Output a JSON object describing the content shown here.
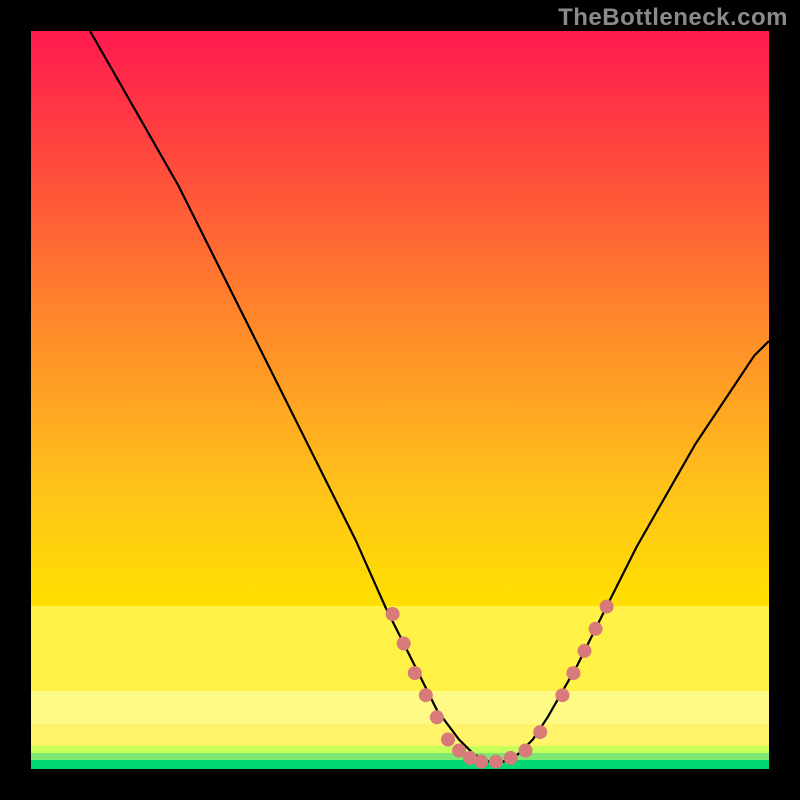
{
  "watermark": "TheBottleneck.com",
  "chart_data": {
    "type": "line",
    "title": "",
    "xlabel": "",
    "ylabel": "",
    "xlim": [
      0,
      100
    ],
    "ylim": [
      0,
      100
    ],
    "grid": false,
    "background": {
      "top_color": "#ff1a4f",
      "mid_color": "#ffd400",
      "bottom_color": "#00e070",
      "highlight_band": true,
      "highlight_color": "#ffff99"
    },
    "series": [
      {
        "name": "bottleneck-curve",
        "color": "#000000",
        "x": [
          8,
          12,
          16,
          20,
          24,
          28,
          32,
          36,
          40,
          44,
          48,
          52,
          55,
          58,
          60,
          62,
          64,
          66,
          68,
          70,
          74,
          78,
          82,
          86,
          90,
          94,
          98,
          100
        ],
        "y": [
          100,
          93,
          86,
          79,
          71,
          63,
          55,
          47,
          39,
          31,
          22,
          14,
          8,
          4,
          2,
          1,
          1,
          2,
          4,
          7,
          14,
          22,
          30,
          37,
          44,
          50,
          56,
          58
        ]
      }
    ],
    "markers": {
      "name": "highlight-dots",
      "color": "#d97a7a",
      "radius": 7,
      "points": [
        {
          "x": 49,
          "y": 21
        },
        {
          "x": 50.5,
          "y": 17
        },
        {
          "x": 52,
          "y": 13
        },
        {
          "x": 53.5,
          "y": 10
        },
        {
          "x": 55,
          "y": 7
        },
        {
          "x": 56.5,
          "y": 4
        },
        {
          "x": 58,
          "y": 2.5
        },
        {
          "x": 59.5,
          "y": 1.5
        },
        {
          "x": 61,
          "y": 1
        },
        {
          "x": 63,
          "y": 1
        },
        {
          "x": 65,
          "y": 1.5
        },
        {
          "x": 67,
          "y": 2.5
        },
        {
          "x": 69,
          "y": 5
        },
        {
          "x": 72,
          "y": 10
        },
        {
          "x": 73.5,
          "y": 13
        },
        {
          "x": 75,
          "y": 16
        },
        {
          "x": 76.5,
          "y": 19
        },
        {
          "x": 78,
          "y": 22
        }
      ]
    }
  }
}
